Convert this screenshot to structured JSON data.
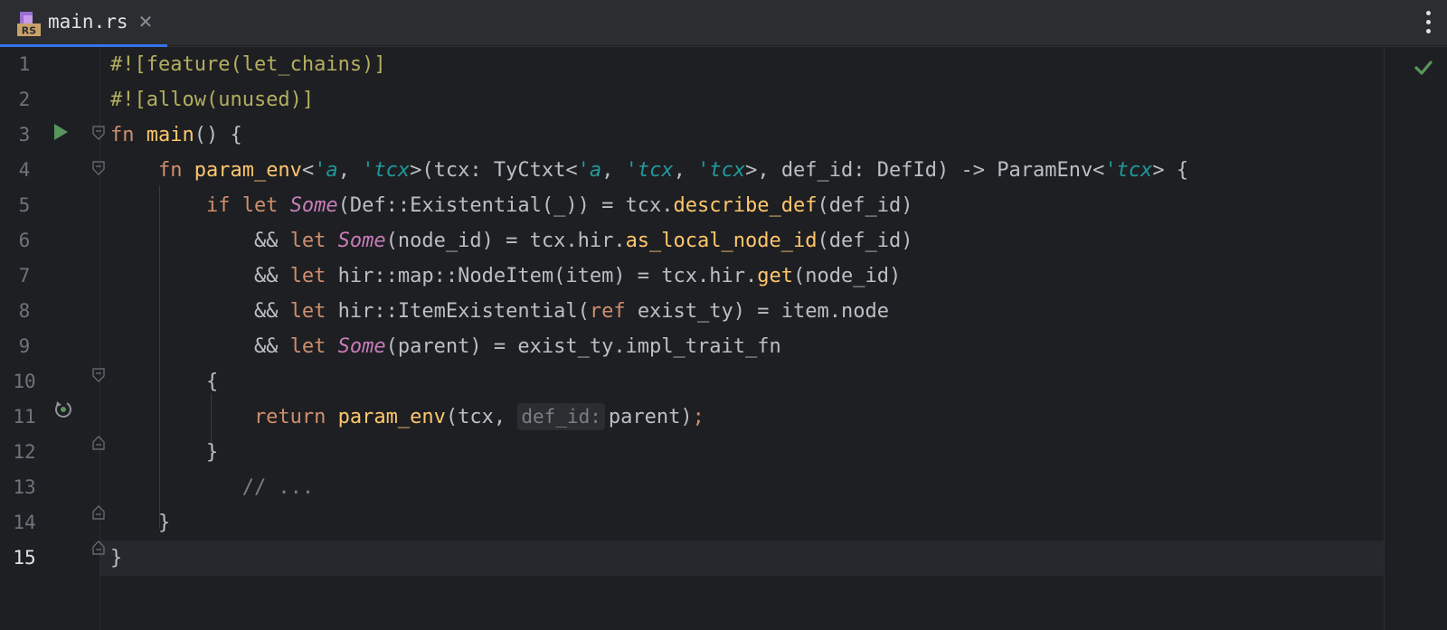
{
  "tab": {
    "file_name": "main.rs",
    "file_icon": "rust-file-icon",
    "file_icon_label": "RS",
    "close_glyph": "✕"
  },
  "editor": {
    "status_icon": "checkmark-icon",
    "current_line": 15,
    "line_numbers": [
      "1",
      "2",
      "3",
      "4",
      "5",
      "6",
      "7",
      "8",
      "9",
      "10",
      "11",
      "12",
      "13",
      "14",
      "15"
    ],
    "lines": [
      [
        {
          "t": "#![feature(let_chains)]",
          "c": "attr"
        }
      ],
      [
        {
          "t": "#![allow(unused)]",
          "c": "attr"
        }
      ],
      [
        {
          "t": "fn ",
          "c": "k"
        },
        {
          "t": "main",
          "c": "fn"
        },
        {
          "t": "() {",
          "c": ""
        }
      ],
      [
        {
          "t": "    fn ",
          "c": "k"
        },
        {
          "t": "param_env",
          "c": "fn"
        },
        {
          "t": "<",
          "c": ""
        },
        {
          "t": "'a",
          "c": "life"
        },
        {
          "t": ", ",
          "c": ""
        },
        {
          "t": "'tcx",
          "c": "life"
        },
        {
          "t": ">(tcx: TyCtxt<",
          "c": ""
        },
        {
          "t": "'a",
          "c": "life"
        },
        {
          "t": ", ",
          "c": ""
        },
        {
          "t": "'tcx",
          "c": "life"
        },
        {
          "t": ", ",
          "c": ""
        },
        {
          "t": "'tcx",
          "c": "life"
        },
        {
          "t": ">, def_id: DefId) -> ParamEnv<",
          "c": ""
        },
        {
          "t": "'tcx",
          "c": "life"
        },
        {
          "t": "> {",
          "c": ""
        }
      ],
      [
        {
          "t": "        if let ",
          "c": "k"
        },
        {
          "t": "Some",
          "c": "enum"
        },
        {
          "t": "(Def::Existential(_)) = tcx.",
          "c": ""
        },
        {
          "t": "describe_def",
          "c": "fn"
        },
        {
          "t": "(def_id)",
          "c": ""
        }
      ],
      [
        {
          "t": "            && ",
          "c": ""
        },
        {
          "t": "let ",
          "c": "k"
        },
        {
          "t": "Some",
          "c": "enum"
        },
        {
          "t": "(node_id) = tcx.hir.",
          "c": ""
        },
        {
          "t": "as_local_node_id",
          "c": "fn"
        },
        {
          "t": "(def_id)",
          "c": ""
        }
      ],
      [
        {
          "t": "            && ",
          "c": ""
        },
        {
          "t": "let ",
          "c": "k"
        },
        {
          "t": "hir::map::NodeItem(item) = tcx.hir.",
          "c": ""
        },
        {
          "t": "get",
          "c": "fn"
        },
        {
          "t": "(node_id)",
          "c": ""
        }
      ],
      [
        {
          "t": "            && ",
          "c": ""
        },
        {
          "t": "let ",
          "c": "k"
        },
        {
          "t": "hir::ItemExistential(",
          "c": ""
        },
        {
          "t": "ref ",
          "c": "k"
        },
        {
          "t": "exist_ty) = item.node",
          "c": ""
        }
      ],
      [
        {
          "t": "            && ",
          "c": ""
        },
        {
          "t": "let ",
          "c": "k"
        },
        {
          "t": "Some",
          "c": "enum"
        },
        {
          "t": "(parent) = exist_ty.impl_trait_fn",
          "c": ""
        }
      ],
      [
        {
          "t": "        {",
          "c": ""
        }
      ],
      [
        {
          "t": "            return ",
          "c": "k"
        },
        {
          "t": "param_env",
          "c": "fn"
        },
        {
          "t": "(tcx, ",
          "c": ""
        },
        {
          "t": "def_id:",
          "c": "hint"
        },
        {
          "t": "parent)",
          "c": ""
        },
        {
          "t": ";",
          "c": "k"
        }
      ],
      [
        {
          "t": "        }",
          "c": ""
        }
      ],
      [
        {
          "t": "           // ...",
          "c": "cm"
        }
      ],
      [
        {
          "t": "    }",
          "c": ""
        }
      ],
      [
        {
          "t": "}",
          "c": ""
        }
      ]
    ]
  }
}
